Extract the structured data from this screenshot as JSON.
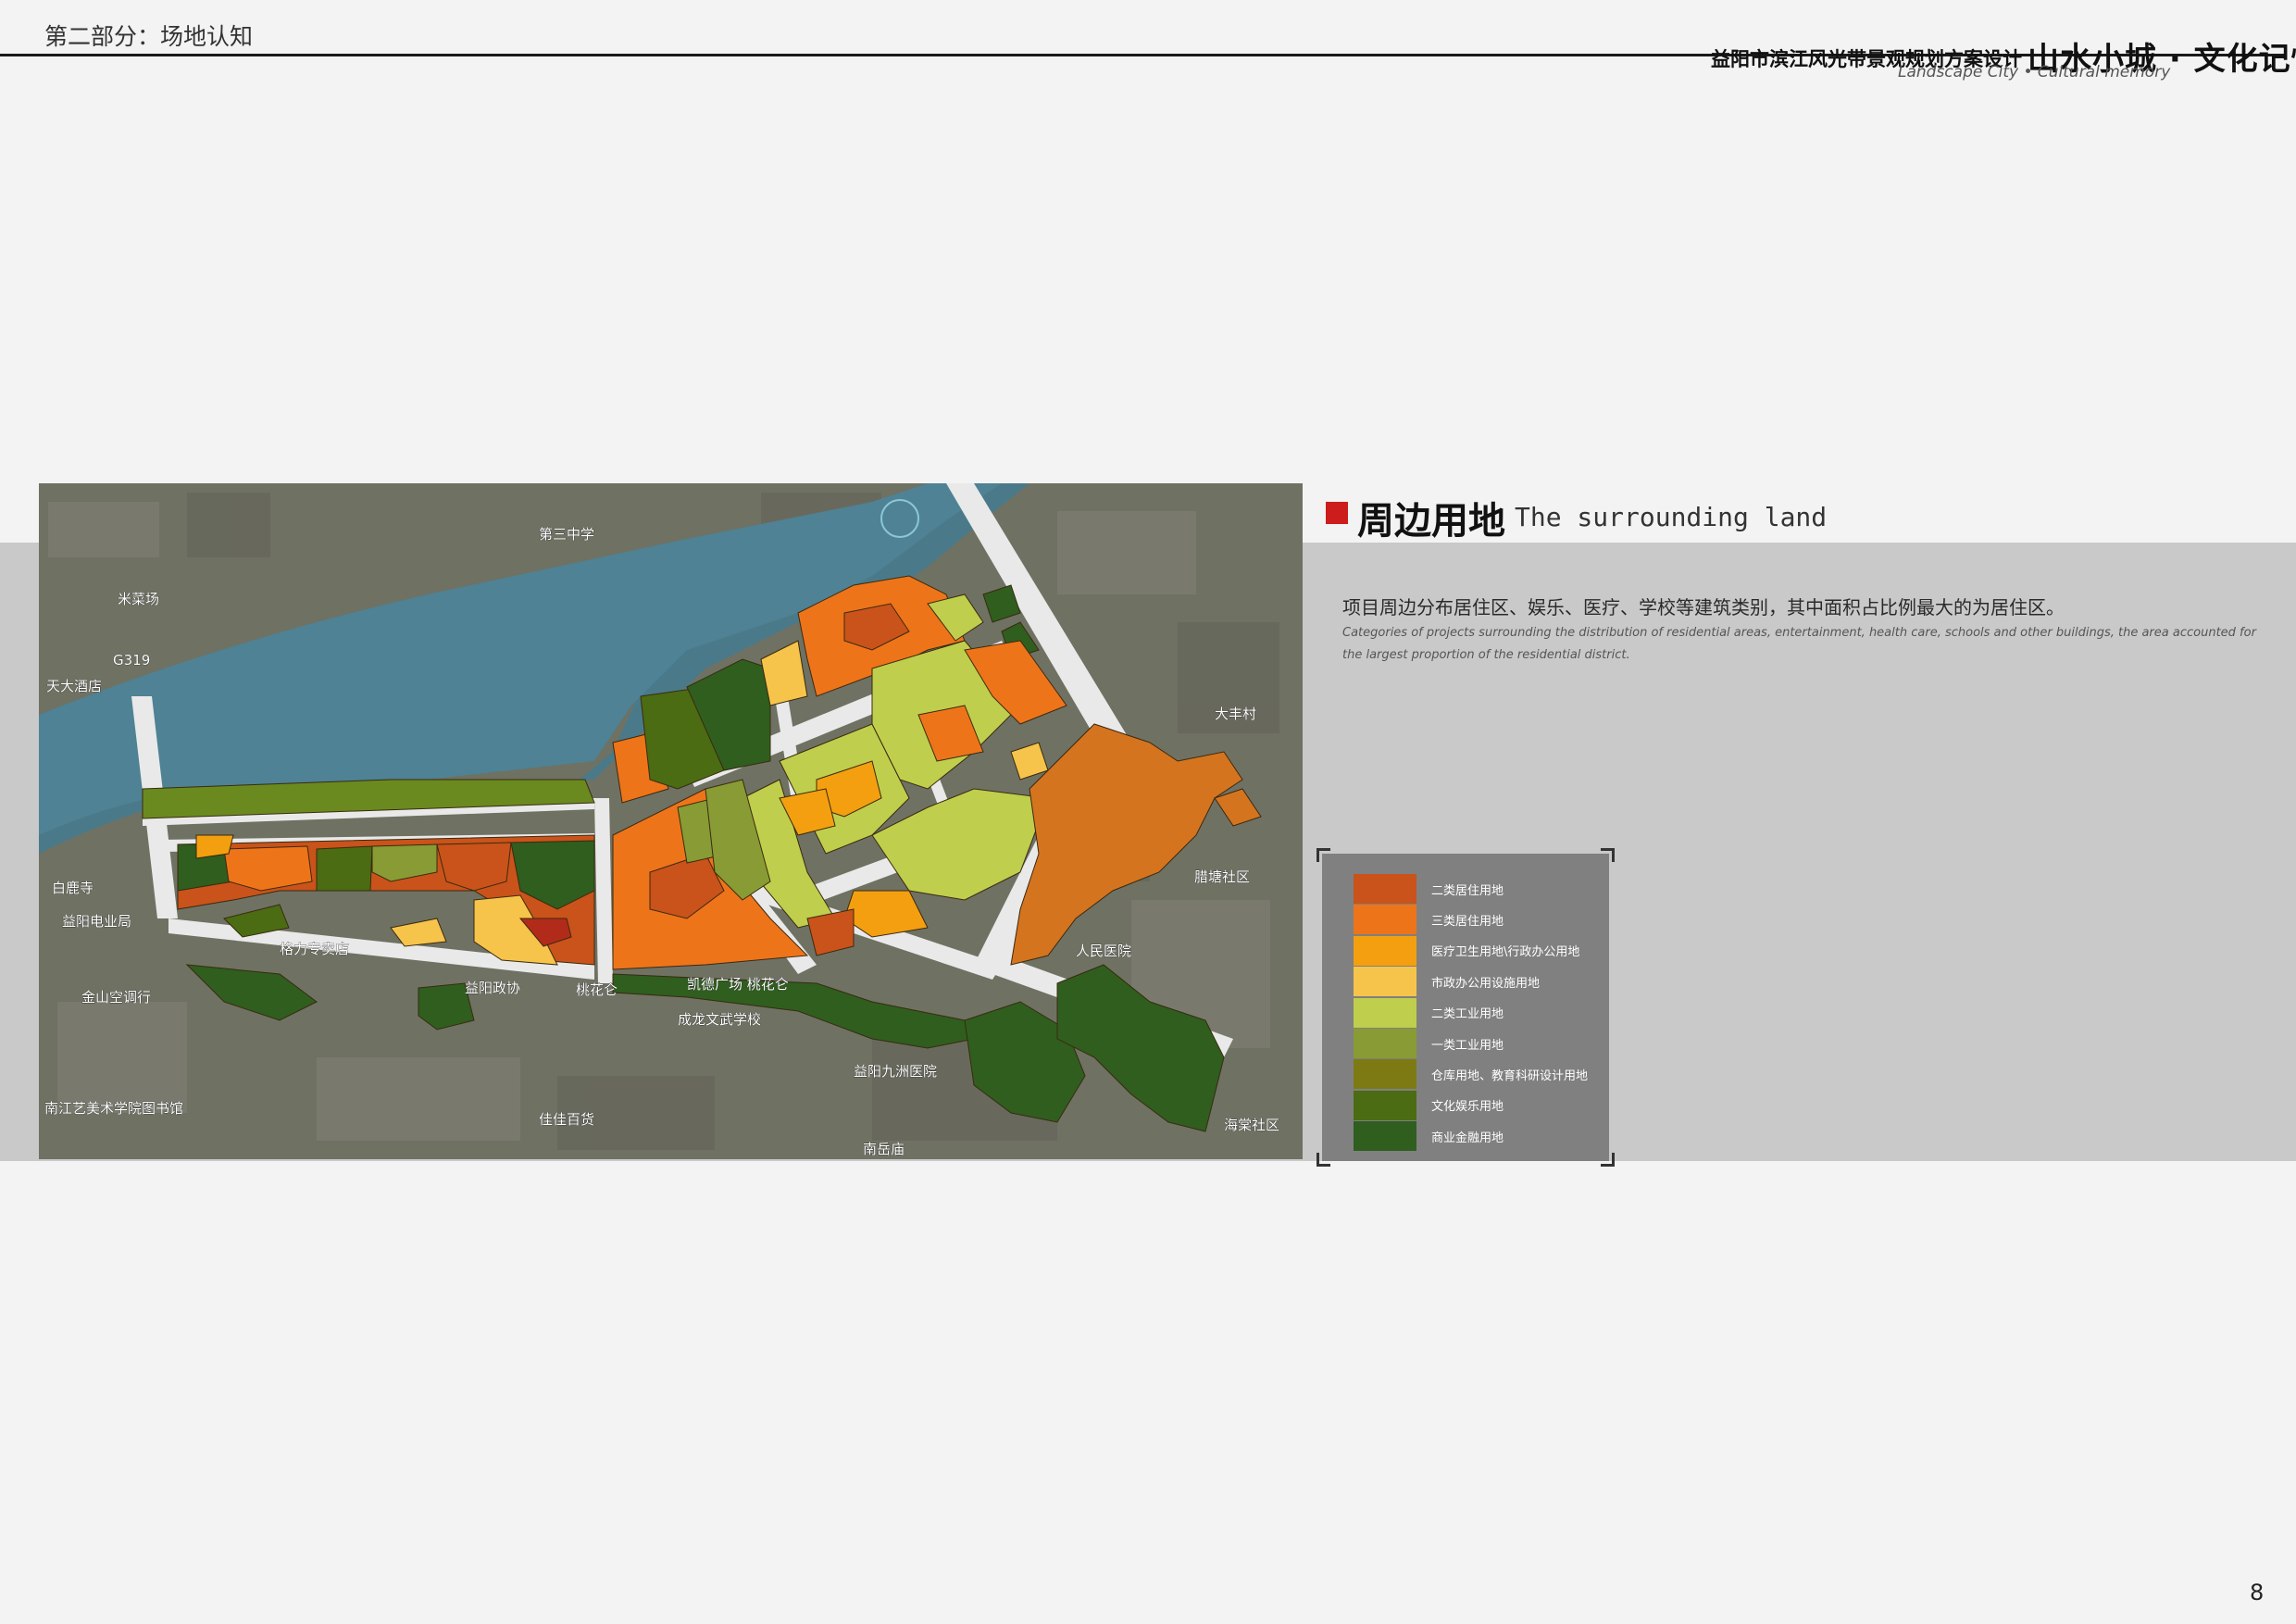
{
  "header": {
    "section_label": "第二部分：场地认知",
    "project_title": "益阳市滨江风光带景观规划方案设计",
    "slogan_cn": "山水小城 · 文化记忆",
    "slogan_en": "Landscape City • Cultural memory"
  },
  "section": {
    "heading_cn": "周边用地",
    "heading_en": "The surrounding land",
    "description_cn": "项目周边分布居住区、娱乐、医疗、学校等建筑类别，其中面积占比例最大的为居住区。",
    "description_en": "Categories of projects surrounding the distribution of residential areas, entertainment, health care, schools and other buildings, the area accounted for the largest proportion of the residential district."
  },
  "map": {
    "labels": [
      "米菜场",
      "G319",
      "天大酒店",
      "白鹿寺",
      "益阳电业局",
      "金山空调行",
      "南江艺美术学院图书馆",
      "格力专卖店",
      "益阳政协",
      "桃花仑",
      "凯德广场 桃花仑",
      "成龙文武学校",
      "益阳九洲医院",
      "佳佳百货",
      "南岳庙",
      "第三中学",
      "大丰村",
      "腊塘社区",
      "海棠社区",
      "人民医院"
    ]
  },
  "legend": {
    "items": [
      {
        "label": "二类居住用地",
        "color": "#c9531a"
      },
      {
        "label": "三类居住用地",
        "color": "#ee741a"
      },
      {
        "label": "医疗卫生用地\\行政办公用地",
        "color": "#f39f10"
      },
      {
        "label": "市政办公用设施用地",
        "color": "#f6c44a"
      },
      {
        "label": "二类工业用地",
        "color": "#bfce4c"
      },
      {
        "label": "一类工业用地",
        "color": "#889b34"
      },
      {
        "label": "仓库用地、教育科研设计用地",
        "color": "#7d7a14"
      },
      {
        "label": "文化娱乐用地",
        "color": "#4b6c12"
      },
      {
        "label": "商业金融用地",
        "color": "#2f5e1e"
      }
    ]
  },
  "page_number": "8"
}
